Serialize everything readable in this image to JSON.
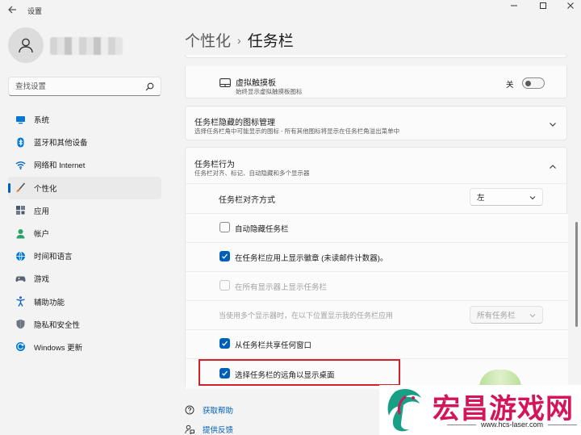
{
  "window": {
    "title": "设置"
  },
  "sidebar": {
    "search_placeholder": "查找设置",
    "items": [
      {
        "label": "系统",
        "icon": "system-icon",
        "color": "#0078d4"
      },
      {
        "label": "蓝牙和其他设备",
        "icon": "bluetooth-icon",
        "color": "#0078d4"
      },
      {
        "label": "网络和 Internet",
        "icon": "wifi-icon",
        "color": "#0067c0"
      },
      {
        "label": "个性化",
        "icon": "brush-icon",
        "color": "#e07a2c",
        "active": true
      },
      {
        "label": "应用",
        "icon": "apps-icon",
        "color": "#4a5a6e"
      },
      {
        "label": "帐户",
        "icon": "account-icon",
        "color": "#2aa36b"
      },
      {
        "label": "时间和语言",
        "icon": "globe-clock-icon",
        "color": "#0078d4"
      },
      {
        "label": "游戏",
        "icon": "gamepad-icon",
        "color": "#5a6270"
      },
      {
        "label": "辅助功能",
        "icon": "accessibility-icon",
        "color": "#1565c0"
      },
      {
        "label": "隐私和安全性",
        "icon": "shield-icon",
        "color": "#6e7681"
      },
      {
        "label": "Windows 更新",
        "icon": "windows-update-icon",
        "color": "#0078d4"
      }
    ]
  },
  "header": {
    "parent": "个性化",
    "current": "任务栏"
  },
  "content": {
    "touchpad": {
      "title": "虚拟触摸板",
      "subtitle": "始终显示虚拟触摸板图标",
      "toggle_label": "关"
    },
    "overflow": {
      "title": "任务栏隐藏的图标管理",
      "subtitle": "选择任务栏角中可能显示的图标 - 所有其他图标将显示在任务栏角溢出菜单中"
    },
    "behaviors": {
      "title": "任务栏行为",
      "subtitle": "任务栏对齐、标记、自动隐藏和多个显示器",
      "alignment_label": "任务栏对齐方式",
      "alignment_value": "左",
      "autohide_label": "自动隐藏任务栏",
      "badges_label": "在任务栏应用上显示徽章 (未读邮件计数器)。",
      "all_displays_label": "在所有显示器上显示任务栏",
      "multi_display_label": "当使用多个显示器时，在以下位置显示我的任务栏应用",
      "multi_display_value": "所有任务栏",
      "share_label": "从任务栏共享任何窗口",
      "corner_label": "选择任务栏的远角以显示桌面"
    }
  },
  "links": {
    "help": "获取帮助",
    "feedback": "提供反馈"
  },
  "watermark": {
    "brand": "宏昌游戏网",
    "url": "www.hcs-laser.com"
  },
  "colors": {
    "accent": "#005fb8",
    "highlight": "#d3202a",
    "watermark": "#d3165a"
  }
}
